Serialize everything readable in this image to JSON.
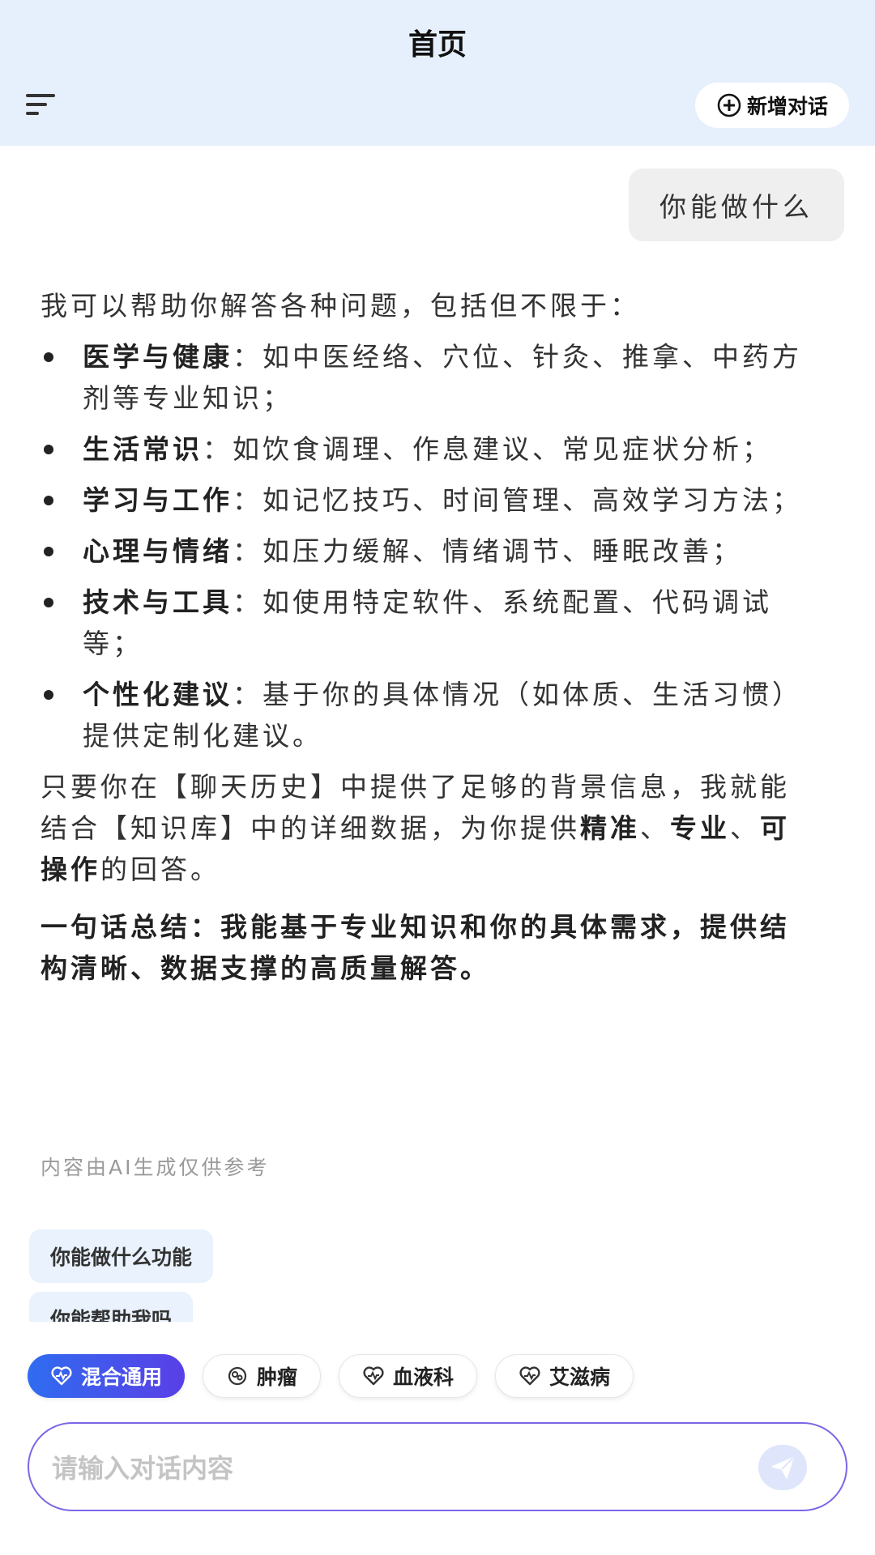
{
  "header": {
    "title": "首页",
    "new_chat_label": "新增对话"
  },
  "user_message": "你能做什么",
  "answer": {
    "intro": "我可以帮助你解答各种问题，包括但不限于：",
    "items": [
      {
        "term": "医学与健康",
        "text": "：如中医经络、穴位、针灸、推拿、中药方剂等专业知识；"
      },
      {
        "term": "生活常识",
        "text": "：如饮食调理、作息建议、常见症状分析；"
      },
      {
        "term": "学习与工作",
        "text": "：如记忆技巧、时间管理、高效学习方法；"
      },
      {
        "term": "心理与情绪",
        "text": "：如压力缓解、情绪调节、睡眠改善；"
      },
      {
        "term": "技术与工具",
        "text": "：如使用特定软件、系统配置、代码调试等；"
      },
      {
        "term": "个性化建议",
        "text": "：基于你的具体情况（如体质、生活习惯）提供定制化建议。"
      }
    ],
    "para_a": "只要你在【聊天历史】中提供了足够的背景信息，我就能结合【知识库】中的详细数据，为你提供",
    "para_b": "精准",
    "para_c": "、",
    "para_d": "专业",
    "para_e": "、",
    "para_f": "可操作",
    "para_g": "的回答。",
    "summary": "一句话总结：我能基于专业知识和你的具体需求，提供结构清晰、数据支撑的高质量解答。"
  },
  "disclaimer": "内容由AI生成仅供参考",
  "suggestions": [
    "你能做什么功能",
    "你能帮助我吗"
  ],
  "chips": [
    {
      "label": "混合通用",
      "icon": "heart-pulse-icon",
      "active": true
    },
    {
      "label": "肿瘤",
      "icon": "tumor-icon",
      "active": false
    },
    {
      "label": "血液科",
      "icon": "heart-pulse-icon",
      "active": false
    },
    {
      "label": "艾滋病",
      "icon": "heart-pulse-icon",
      "active": false
    }
  ],
  "input": {
    "placeholder": "请输入对话内容",
    "value": ""
  },
  "colors": {
    "header_bg": "#e6f0fc",
    "accent": "#2f6cf0",
    "input_border": "#7a66e8"
  }
}
